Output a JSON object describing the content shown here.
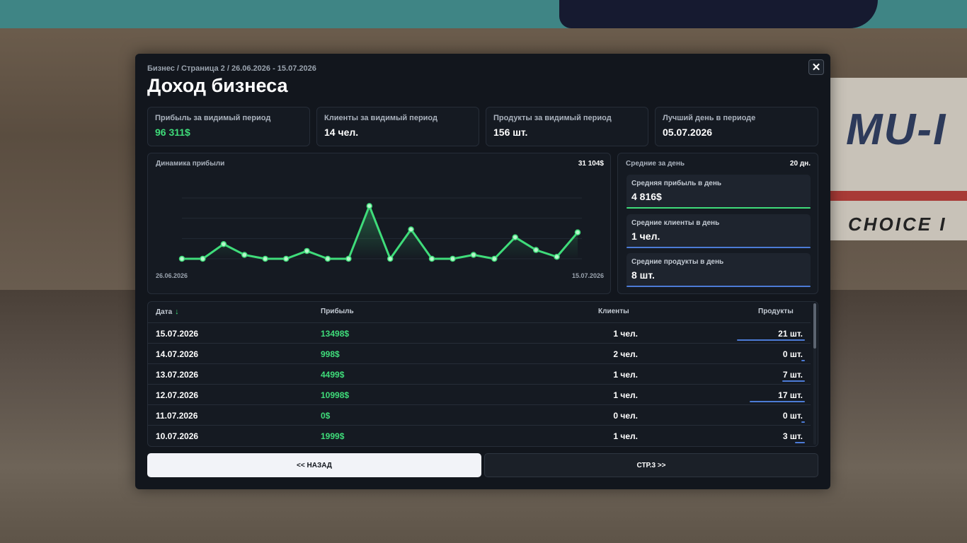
{
  "header": {
    "breadcrumb": "Бизнес / Страница 2 / 26.06.2026 - 15.07.2026",
    "title": "Доход бизнеса",
    "close_label": "✕"
  },
  "cards": [
    {
      "label": "Прибыль за видимый период",
      "value": "96 311$"
    },
    {
      "label": "Клиенты за видимый период",
      "value": "14 чел."
    },
    {
      "label": "Продукты за видимый период",
      "value": "156 шт."
    },
    {
      "label": "Лучший день в периоде",
      "value": "05.07.2026"
    }
  ],
  "chart": {
    "title": "Динамика прибыли",
    "total": "31 104$",
    "start_label": "26.06.2026",
    "end_label": "15.07.2026"
  },
  "chart_data": {
    "type": "area",
    "title": "Динамика прибыли",
    "x": [
      "26.06.2026",
      "27.06.2026",
      "28.06.2026",
      "29.06.2026",
      "30.06.2026",
      "01.07.2026",
      "02.07.2026",
      "03.07.2026",
      "04.07.2026",
      "05.07.2026",
      "06.07.2026",
      "07.07.2026",
      "08.07.2026",
      "09.07.2026",
      "10.07.2026",
      "11.07.2026",
      "12.07.2026",
      "13.07.2026",
      "14.07.2026",
      "15.07.2026"
    ],
    "values": [
      0,
      0,
      7500,
      1999,
      0,
      0,
      4000,
      0,
      0,
      27000,
      0,
      15000,
      0,
      0,
      1999,
      0,
      10998,
      4499,
      998,
      13498
    ],
    "ylim": [
      0,
      31104
    ],
    "grid": true,
    "line_color": "#3fdc7a"
  },
  "averages": {
    "title": "Средние за день",
    "days": "20 дн.",
    "items": [
      {
        "label": "Средняя прибыль в день",
        "value": "4 816$",
        "color": "#3fdc7a"
      },
      {
        "label": "Средние клиенты в день",
        "value": "1 чел.",
        "color": "#4c7bd6"
      },
      {
        "label": "Средние продукты в день",
        "value": "8 шт.",
        "color": "#4c7bd6"
      }
    ]
  },
  "table": {
    "headers": {
      "date": "Дата",
      "profit": "Прибыль",
      "clients": "Клиенты",
      "products": "Продукты"
    },
    "sort_icon": "arrow-down-icon",
    "rows": [
      {
        "date": "15.07.2026",
        "profit": "13498$",
        "clients": "1 чел.",
        "products": "21 шт.",
        "products_count": 21
      },
      {
        "date": "14.07.2026",
        "profit": "998$",
        "clients": "2 чел.",
        "products": "0 шт.",
        "products_count": 0
      },
      {
        "date": "13.07.2026",
        "profit": "4499$",
        "clients": "1 чел.",
        "products": "7 шт.",
        "products_count": 7
      },
      {
        "date": "12.07.2026",
        "profit": "10998$",
        "clients": "1 чел.",
        "products": "17 шт.",
        "products_count": 17
      },
      {
        "date": "11.07.2026",
        "profit": "0$",
        "clients": "0 чел.",
        "products": "0 шт.",
        "products_count": 0
      },
      {
        "date": "10.07.2026",
        "profit": "1999$",
        "clients": "1 чел.",
        "products": "3 шт.",
        "products_count": 3
      }
    ]
  },
  "buttons": {
    "back": "<< НАЗАД",
    "next": "СТР.3 >>"
  },
  "background": {
    "sign_text": "MU-I",
    "sign_subtext": "CHOICE I"
  }
}
